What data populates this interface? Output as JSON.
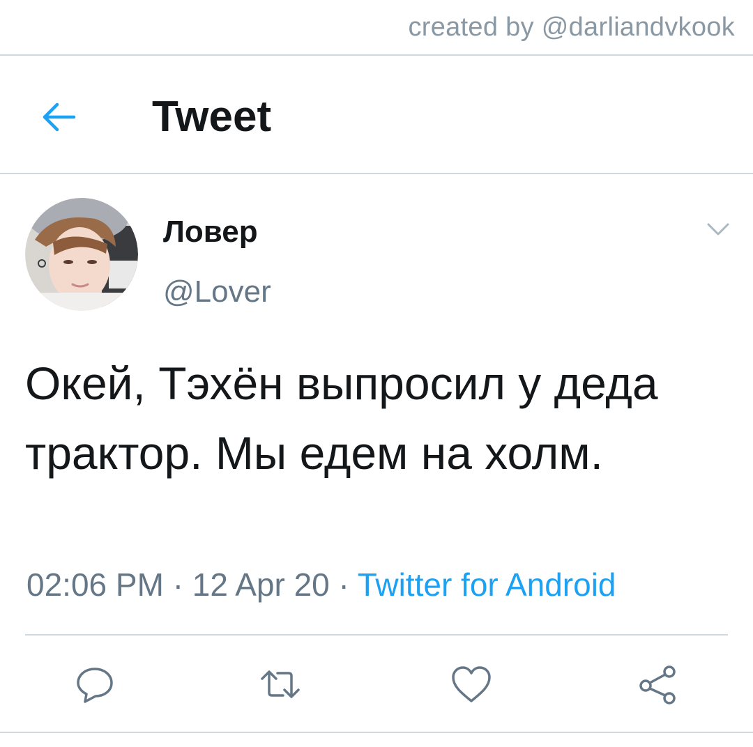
{
  "watermark": {
    "text": "created by @darliandvkook"
  },
  "header": {
    "title": "Tweet",
    "back_icon": "arrow-left-icon"
  },
  "tweet": {
    "author": {
      "display_name": "Ловер",
      "handle": "@Lover"
    },
    "text": "Окей, Тэхён выпросил у деда трактор. Мы едем на холм.",
    "meta": {
      "time": "02:06 PM",
      "separator": "·",
      "date": "12 Apr 20",
      "source": "Twitter for Android"
    },
    "actions": [
      {
        "icon": "reply-icon"
      },
      {
        "icon": "retweet-icon"
      },
      {
        "icon": "like-icon"
      },
      {
        "icon": "share-icon"
      }
    ]
  },
  "colors": {
    "accent": "#1da1f2",
    "text_primary": "#14171a",
    "text_secondary": "#657786",
    "divider": "#cfd8de",
    "watermark": "#8a98a4"
  }
}
